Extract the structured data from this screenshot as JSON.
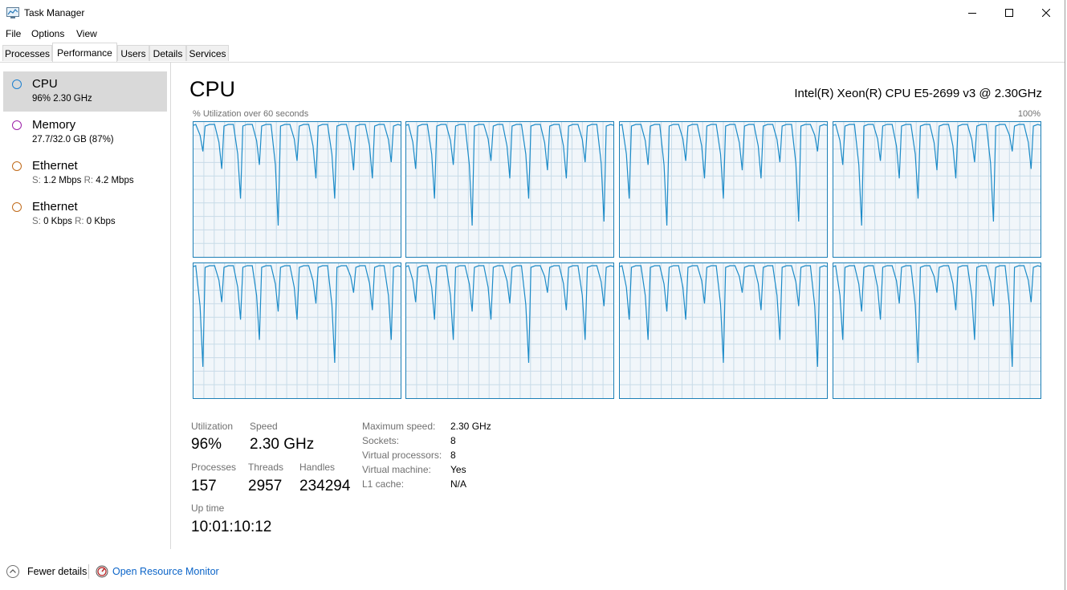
{
  "window": {
    "title": "Task Manager",
    "icon": "task-manager-icon"
  },
  "menu": [
    "File",
    "Options",
    "View"
  ],
  "tabs": [
    {
      "label": "Processes",
      "active": false
    },
    {
      "label": "Performance",
      "active": true
    },
    {
      "label": "Users",
      "active": false
    },
    {
      "label": "Details",
      "active": false
    },
    {
      "label": "Services",
      "active": false
    }
  ],
  "sidebar": {
    "items": [
      {
        "name": "CPU",
        "sub": "96%  2.30 GHz",
        "color": "#1c7fd0",
        "selected": true
      },
      {
        "name": "Memory",
        "sub": "27.7/32.0 GB (87%)",
        "color": "#9b1fa8",
        "selected": false
      },
      {
        "name": "Ethernet",
        "sub_s_label": "S:",
        "sub_s": "1.2 Mbps",
        "sub_r_label": "R:",
        "sub_r": "4.2 Mbps",
        "color": "#c06a1a",
        "selected": false
      },
      {
        "name": "Ethernet",
        "sub_s_label": "S:",
        "sub_s": "0 Kbps",
        "sub_r_label": "R:",
        "sub_r": "0 Kbps",
        "color": "#c06a1a",
        "selected": false
      }
    ]
  },
  "main": {
    "title": "CPU",
    "model": "Intel(R) Xeon(R) CPU E5-2699 v3 @ 2.30GHz",
    "graph_label": "% Utilization over 60 seconds",
    "graph_max": "100%",
    "graph_line_color": "#1c8bc8",
    "graph_grid_color": "#c8dbe8",
    "graph_count": 8
  },
  "stats": {
    "utilization_label": "Utilization",
    "utilization": "96%",
    "speed_label": "Speed",
    "speed": "2.30 GHz",
    "processes_label": "Processes",
    "processes": "157",
    "threads_label": "Threads",
    "threads": "2957",
    "handles_label": "Handles",
    "handles": "234294",
    "uptime_label": "Up time",
    "uptime": "10:01:10:12",
    "details": [
      {
        "key": "Maximum speed:",
        "value": "2.30 GHz"
      },
      {
        "key": "Sockets:",
        "value": "8"
      },
      {
        "key": "Virtual processors:",
        "value": "8"
      },
      {
        "key": "Virtual machine:",
        "value": "Yes"
      },
      {
        "key": "L1 cache:",
        "value": "N/A"
      }
    ]
  },
  "footer": {
    "fewer_details": "Fewer details",
    "resource_monitor": "Open Resource Monitor"
  }
}
